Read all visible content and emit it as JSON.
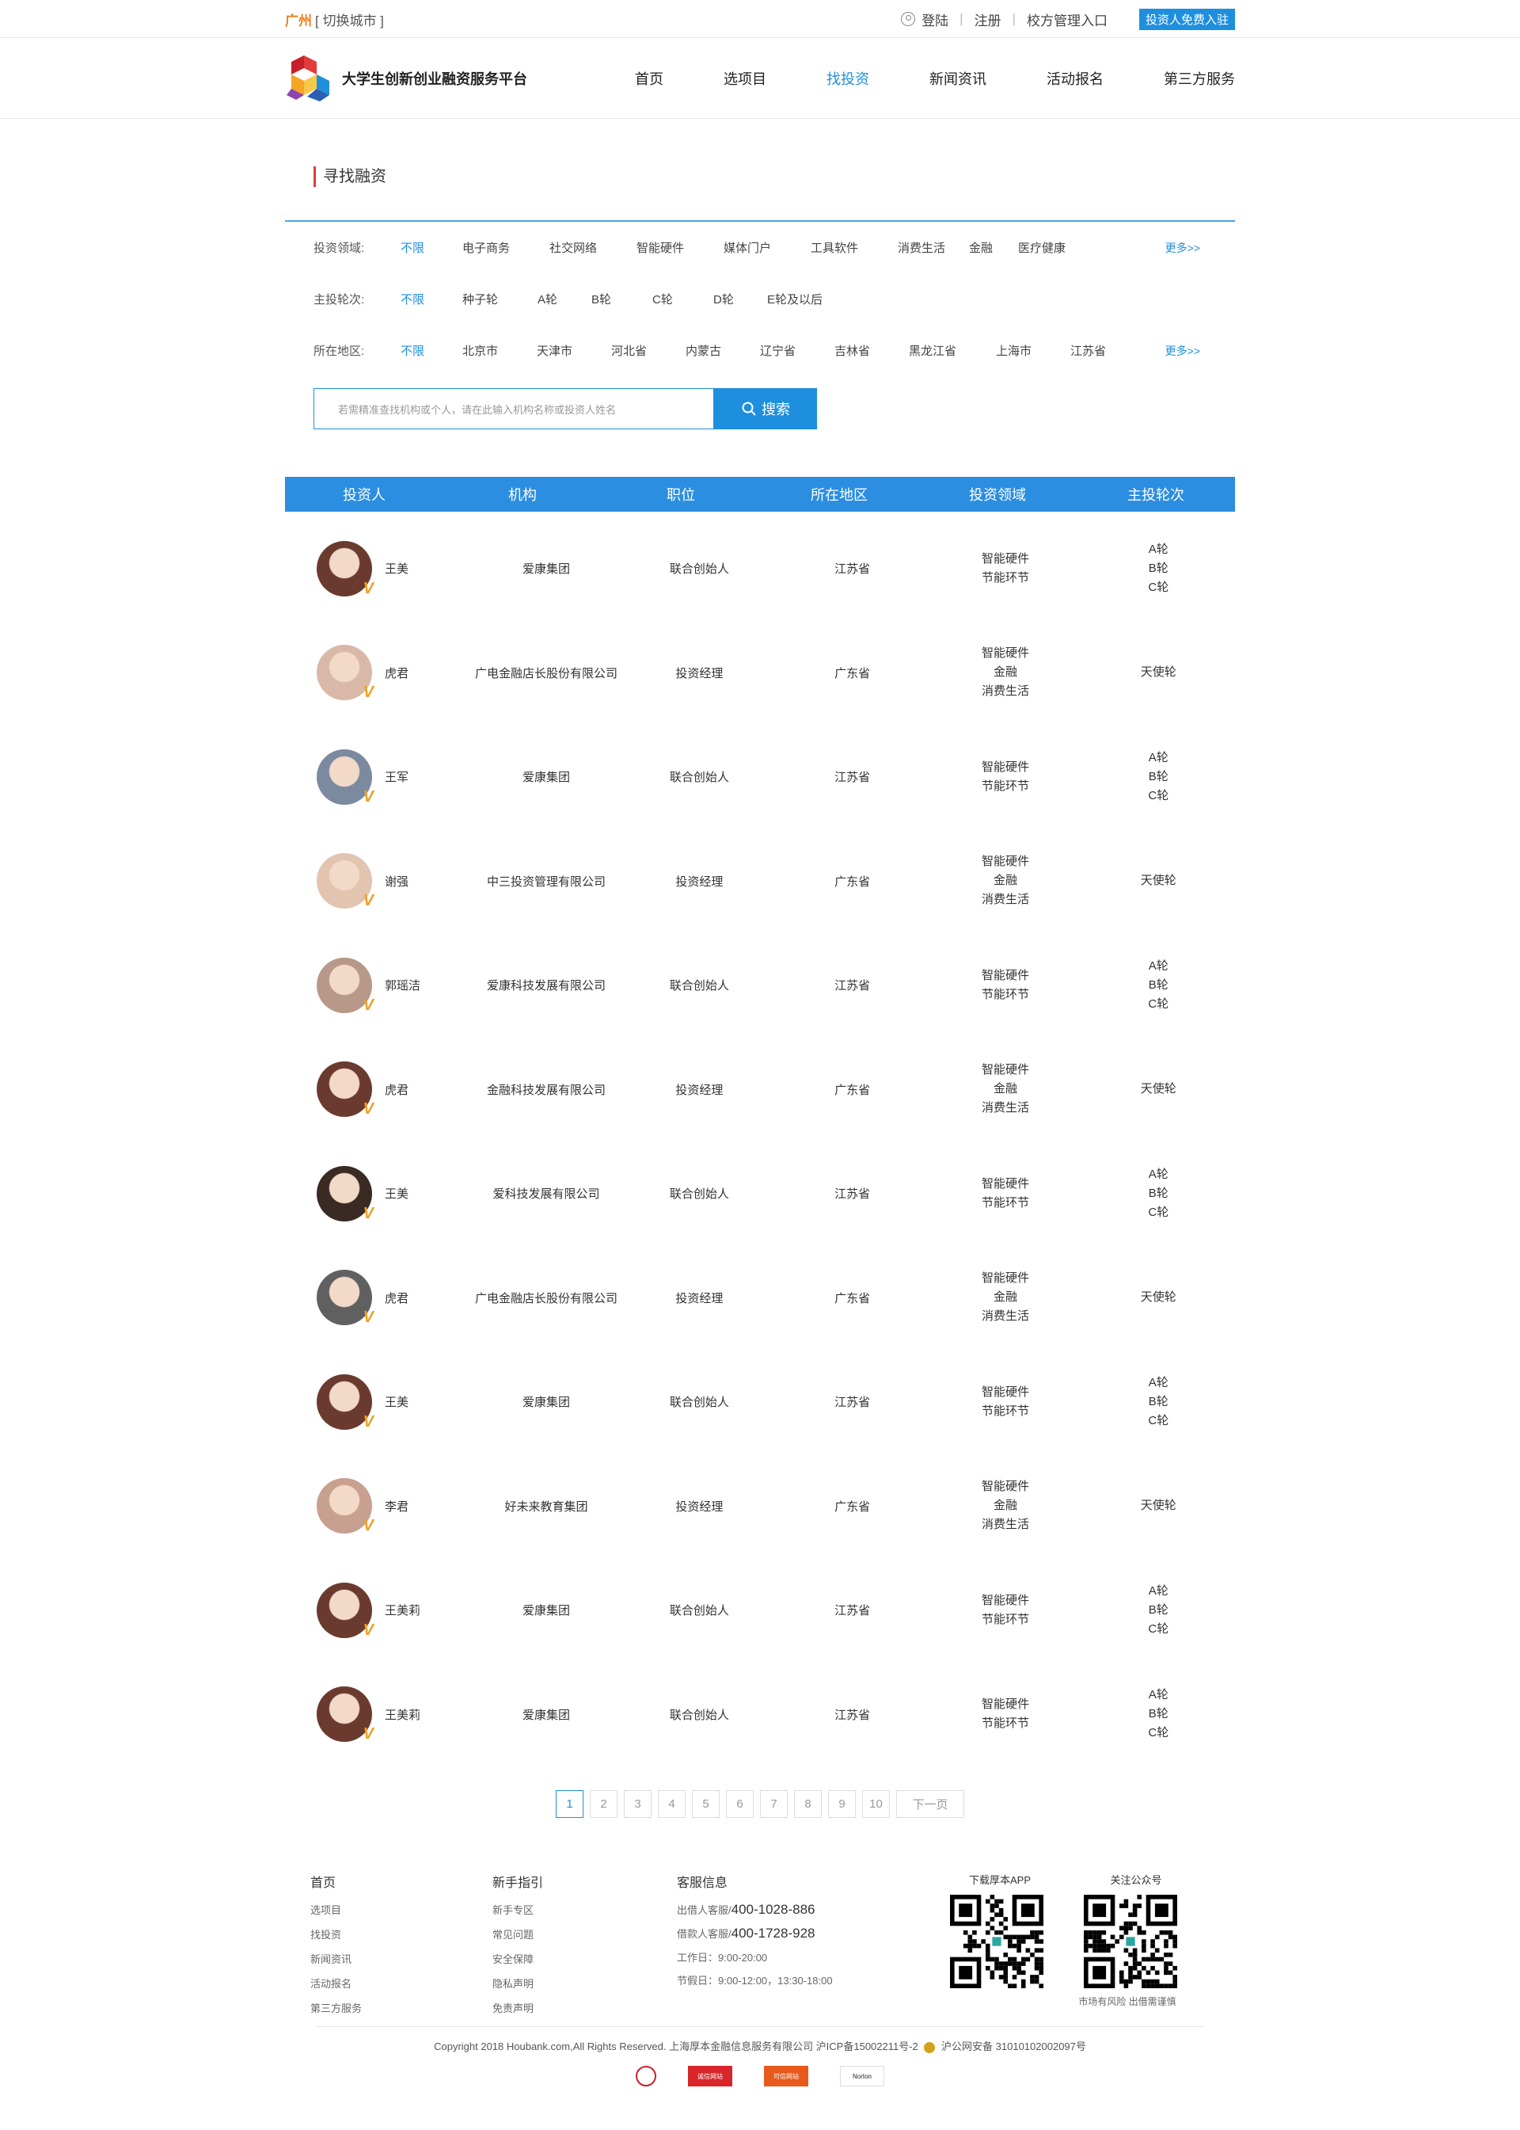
{
  "topbar": {
    "city": "广州",
    "switch_city": "[ 切换城市 ]",
    "login": "登陆",
    "register": "注册",
    "school_admin": "校方管理入口",
    "join_button": "投资人免费入驻"
  },
  "header": {
    "site_name": "大学生创新创业融资服务平台",
    "nav": [
      {
        "label": "首页"
      },
      {
        "label": "选项目"
      },
      {
        "label": "找投资"
      },
      {
        "label": "新闻资讯"
      },
      {
        "label": "活动报名"
      },
      {
        "label": "第三方服务"
      }
    ]
  },
  "section_title": "寻找融资",
  "filters": {
    "field": {
      "label": "投资领域:",
      "options": [
        "不限",
        "电子商务",
        "社交网络",
        "智能硬件",
        "媒体门户",
        "工具软件",
        "消费生活",
        "金融",
        "医疗健康"
      ],
      "more": "更多>>"
    },
    "round": {
      "label": "主投轮次:",
      "options": [
        "不限",
        "种子轮",
        "A轮",
        "B轮",
        "C轮",
        "D轮",
        "E轮及以后"
      ]
    },
    "region": {
      "label": "所在地区:",
      "options": [
        "不限",
        "北京市",
        "天津市",
        "河北省",
        "内蒙古",
        "辽宁省",
        "吉林省",
        "黑龙江省",
        "上海市",
        "江苏省"
      ],
      "more": "更多>>"
    }
  },
  "search": {
    "placeholder": "若需精准查找机构或个人，请在此输入机构名称或投资人姓名",
    "button": "搜索"
  },
  "table": {
    "headers": [
      "投资人",
      "机构",
      "职位",
      "所在地区",
      "投资领域",
      "主投轮次"
    ],
    "rows": [
      {
        "name": "王美",
        "org": "爱康集团",
        "title": "联合创始人",
        "region": "江苏省",
        "fields": [
          "智能硬件",
          "节能环节"
        ],
        "rounds": [
          "A轮",
          "B轮",
          "C轮"
        ],
        "avatar_color": "#6b3a2e"
      },
      {
        "name": "虎君",
        "org": "广电金融店长股份有限公司",
        "title": "投资经理",
        "region": "广东省",
        "fields": [
          "智能硬件",
          "金融",
          "消费生活"
        ],
        "rounds": [
          "天使轮"
        ],
        "avatar_color": "#d9b8a8"
      },
      {
        "name": "王军",
        "org": "爱康集团",
        "title": "联合创始人",
        "region": "江苏省",
        "fields": [
          "智能硬件",
          "节能环节"
        ],
        "rounds": [
          "A轮",
          "B轮",
          "C轮"
        ],
        "avatar_color": "#7c8aa0"
      },
      {
        "name": "谢强",
        "org": "中三投资管理有限公司",
        "title": "投资经理",
        "region": "广东省",
        "fields": [
          "智能硬件",
          "金融",
          "消费生活"
        ],
        "rounds": [
          "天使轮"
        ],
        "avatar_color": "#e2c4b0"
      },
      {
        "name": "郭瑶洁",
        "org": "爱康科技发展有限公司",
        "title": "联合创始人",
        "region": "江苏省",
        "fields": [
          "智能硬件",
          "节能环节"
        ],
        "rounds": [
          "A轮",
          "B轮",
          "C轮"
        ],
        "avatar_color": "#b89888"
      },
      {
        "name": "虎君",
        "org": "金融科技发展有限公司",
        "title": "投资经理",
        "region": "广东省",
        "fields": [
          "智能硬件",
          "金融",
          "消费生活"
        ],
        "rounds": [
          "天使轮"
        ],
        "avatar_color": "#6b3a2e"
      },
      {
        "name": "王美",
        "org": "爱科技发展有限公司",
        "title": "联合创始人",
        "region": "江苏省",
        "fields": [
          "智能硬件",
          "节能环节"
        ],
        "rounds": [
          "A轮",
          "B轮",
          "C轮"
        ],
        "avatar_color": "#3a2a24"
      },
      {
        "name": "虎君",
        "org": "广电金融店长股份有限公司",
        "title": "投资经理",
        "region": "广东省",
        "fields": [
          "智能硬件",
          "金融",
          "消费生活"
        ],
        "rounds": [
          "天使轮"
        ],
        "avatar_color": "#606060"
      },
      {
        "name": "王美",
        "org": "爱康集团",
        "title": "联合创始人",
        "region": "江苏省",
        "fields": [
          "智能硬件",
          "节能环节"
        ],
        "rounds": [
          "A轮",
          "B轮",
          "C轮"
        ],
        "avatar_color": "#6b3a2e"
      },
      {
        "name": "李君",
        "org": "好未来教育集团",
        "title": "投资经理",
        "region": "广东省",
        "fields": [
          "智能硬件",
          "金融",
          "消费生活"
        ],
        "rounds": [
          "天使轮"
        ],
        "avatar_color": "#c8a090"
      },
      {
        "name": "王美莉",
        "org": "爱康集团",
        "title": "联合创始人",
        "region": "江苏省",
        "fields": [
          "智能硬件",
          "节能环节"
        ],
        "rounds": [
          "A轮",
          "B轮",
          "C轮"
        ],
        "avatar_color": "#6b3a2e"
      },
      {
        "name": "王美莉",
        "org": "爱康集团",
        "title": "联合创始人",
        "region": "江苏省",
        "fields": [
          "智能硬件",
          "节能环节"
        ],
        "rounds": [
          "A轮",
          "B轮",
          "C轮"
        ],
        "avatar_color": "#6b3a2e"
      }
    ]
  },
  "pagination": {
    "pages": [
      "1",
      "2",
      "3",
      "4",
      "5",
      "6",
      "7",
      "8",
      "9",
      "10"
    ],
    "current": 1,
    "next": "下一页"
  },
  "footer": {
    "col1": {
      "title": "首页",
      "links": [
        "选项目",
        "找投资",
        "新闻资讯",
        "活动报名",
        "第三方服务"
      ]
    },
    "col2": {
      "title": "新手指引",
      "links": [
        "新手专区",
        "常见问题",
        "安全保障",
        "隐私声明",
        "免责声明"
      ]
    },
    "col3": {
      "title": "客服信息",
      "lender_label": "出借人客服/",
      "lender_phone": "400-1028-886",
      "borrower_label": "借款人客服/",
      "borrower_phone": "400-1728-928",
      "workday": "工作日：9:00-20:00",
      "holiday": "节假日：9:00-12:00，13:30-18:00"
    },
    "app_label": "下载厚本APP",
    "wechat_label": "关注公众号",
    "risk_tip": "市场有风险 出借需谨慎",
    "copyright": "Copyright 2018 Houbank.com,All Rights Reserved.   上海厚本金融信息服务有限公司     沪ICP备15002211号-2",
    "police": "沪公网安备 31010102002097号",
    "badges": [
      "",
      "诚信网站",
      "可信网站",
      "Norton"
    ]
  },
  "colors": {
    "accent": "#1e8fde",
    "city": "#f08020",
    "title_bar": "#e23b3b"
  }
}
